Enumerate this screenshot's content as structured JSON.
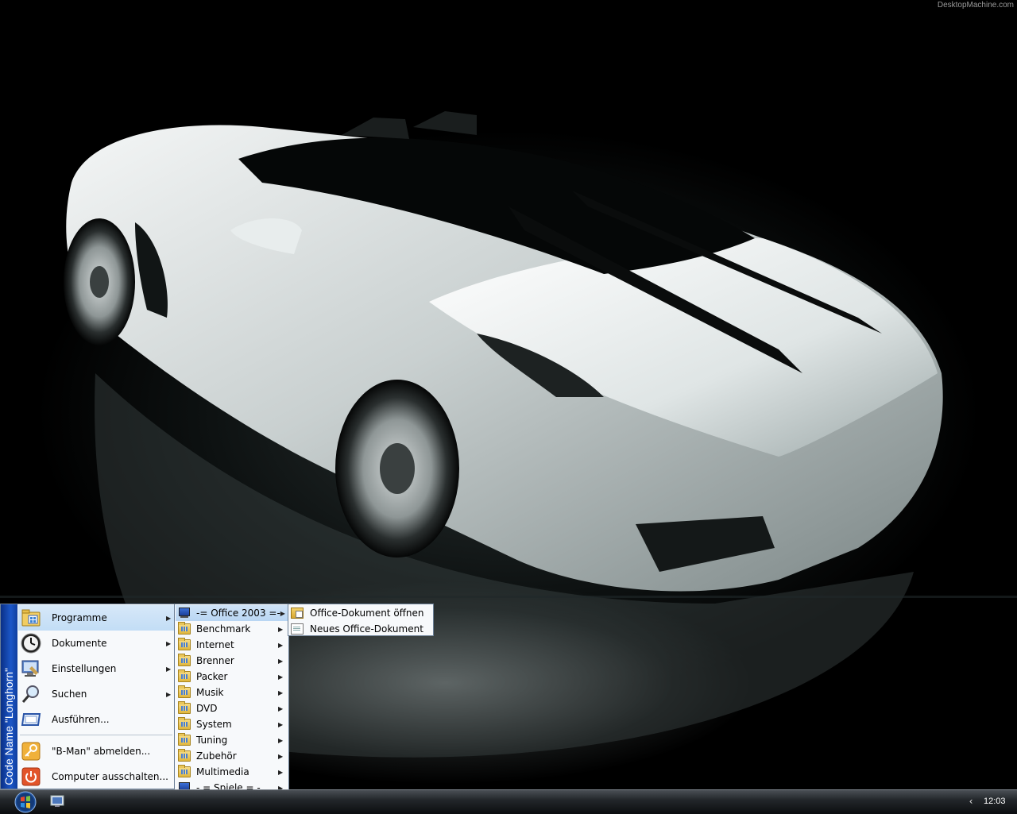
{
  "desktop": {
    "watermark": "DesktopMachine.com"
  },
  "start_menu": {
    "banner_text": "Code Name \"Longhorn\"",
    "items": [
      {
        "label": "Programme",
        "icon": "programs-folder-icon",
        "has_submenu": true,
        "active": true
      },
      {
        "label": "Dokumente",
        "icon": "clock-icon",
        "has_submenu": true
      },
      {
        "label": "Einstellungen",
        "icon": "settings-icon",
        "has_submenu": true
      },
      {
        "label": "Suchen",
        "icon": "magnifier-icon",
        "has_submenu": true
      },
      {
        "label": "Ausführen...",
        "icon": "run-icon",
        "has_submenu": false
      },
      {
        "label": "\"B-Man\" abmelden...",
        "icon": "key-icon",
        "has_submenu": false
      },
      {
        "label": "Computer ausschalten...",
        "icon": "power-icon",
        "has_submenu": false
      }
    ]
  },
  "programs_menu": {
    "items": [
      {
        "label": "-= Office 2003 =-",
        "icon": "computer-icon",
        "active": true
      },
      {
        "label": "Benchmark",
        "icon": "folder-icon"
      },
      {
        "label": "Internet",
        "icon": "folder-icon"
      },
      {
        "label": "Brenner",
        "icon": "folder-icon"
      },
      {
        "label": "Packer",
        "icon": "folder-icon"
      },
      {
        "label": "Musik",
        "icon": "folder-icon"
      },
      {
        "label": "DVD",
        "icon": "folder-icon"
      },
      {
        "label": "System",
        "icon": "folder-icon"
      },
      {
        "label": "Tuning",
        "icon": "folder-icon"
      },
      {
        "label": "Zubehör",
        "icon": "folder-icon"
      },
      {
        "label": "Multimedia",
        "icon": "folder-icon"
      },
      {
        "label": "- = Spiele = -",
        "icon": "computer-icon"
      }
    ]
  },
  "office_menu": {
    "items": [
      {
        "label": "Office-Dokument öffnen",
        "icon": "open-document-icon"
      },
      {
        "label": "Neues Office-Dokument",
        "icon": "new-document-icon"
      }
    ]
  },
  "taskbar": {
    "start_icon": "windows-orb-icon",
    "quick_launch_icon": "show-desktop-icon",
    "tray_icon": "chevron-left-icon",
    "clock": "12:03"
  },
  "colors": {
    "menu_highlight": "#c2ddf6",
    "banner_blue": "#1c57c8",
    "taskbar_dark": "#0b0d0f"
  }
}
